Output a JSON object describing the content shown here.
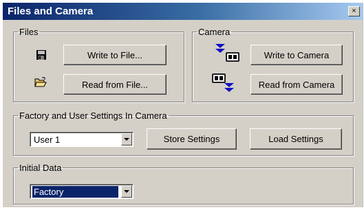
{
  "window": {
    "title": "Files and Camera",
    "close_glyph": "×"
  },
  "files": {
    "legend": "Files",
    "write_label": "Write to File...",
    "read_label": "Read from File...",
    "icons": [
      "save-icon",
      "open-folder-icon"
    ]
  },
  "camera": {
    "legend": "Camera",
    "write_label": "Write to Camera",
    "read_label": "Read from Camera",
    "icons": [
      "camera-download-icon",
      "camera-upload-icon"
    ]
  },
  "settings": {
    "legend": "Factory and User Settings In Camera",
    "selected": "User 1",
    "store_label": "Store Settings",
    "load_label": "Load Settings"
  },
  "initial": {
    "legend": "Initial Data",
    "selected": "Factory"
  },
  "colors": {
    "title_start": "#0a246a",
    "title_end": "#a6caf0",
    "face": "#d4d0c8",
    "arrow": "#1010c0"
  }
}
